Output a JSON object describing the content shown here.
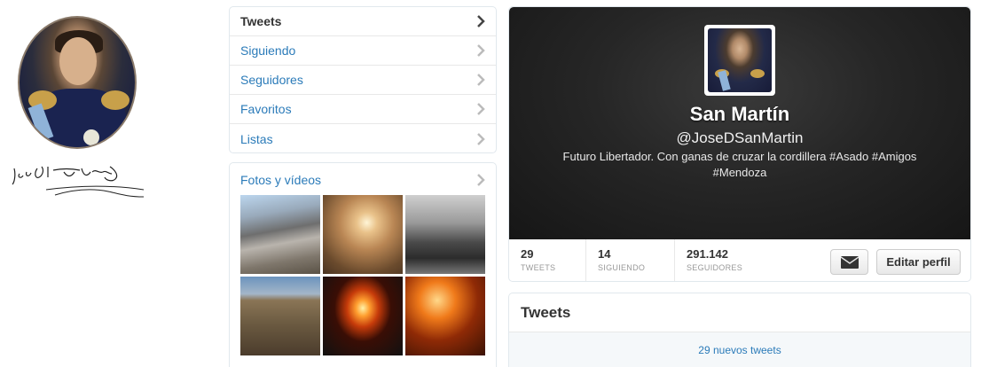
{
  "nav": {
    "items": [
      {
        "label": "Tweets",
        "active": true
      },
      {
        "label": "Siguiendo",
        "active": false
      },
      {
        "label": "Seguidores",
        "active": false
      },
      {
        "label": "Favoritos",
        "active": false
      },
      {
        "label": "Listas",
        "active": false
      }
    ]
  },
  "media": {
    "title": "Fotos y vídeos"
  },
  "profile": {
    "name": "San Martín",
    "handle": "@JoseDSanMartin",
    "bio": "Futuro Libertador. Con ganas de cruzar la cordillera #Asado #Amigos #Mendoza"
  },
  "stats": [
    {
      "value": "29",
      "label": "TWEETS"
    },
    {
      "value": "14",
      "label": "SIGUIENDO"
    },
    {
      "value": "291.142",
      "label": "SEGUIDORES"
    }
  ],
  "actions": {
    "edit_profile": "Editar perfil"
  },
  "tweets": {
    "title": "Tweets",
    "new_tweets": "29 nuevos tweets"
  },
  "colors": {
    "link": "#2b7bb9",
    "hero_bg": "#1e1e1e"
  }
}
